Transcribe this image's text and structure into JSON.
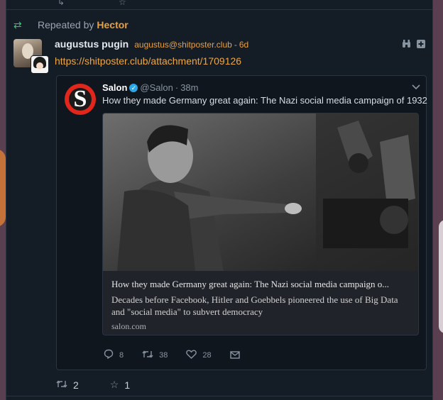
{
  "notice": {
    "prefix": "Repeated by",
    "user": "Hector"
  },
  "status": {
    "display_name": "augustus pugin",
    "account": "augustus@shitposter.club",
    "separator": "-",
    "time": "6d",
    "link": "https://shitposter.club/attachment/1709126"
  },
  "quote": {
    "name": "Salon",
    "handle": "@Salon",
    "separator": "·",
    "time": "38m",
    "text": "How they made Germany great again: The Nazi social media campaign of 1932",
    "preview": {
      "title": "How they made Germany great again: The Nazi social media campaign o...",
      "description": "Decades before Facebook, Hitler and Goebbels pioneered the use of Big Data and \"social media\" to subvert democracy",
      "domain": "salon.com"
    },
    "actions": {
      "replies": "8",
      "retweets": "38",
      "likes": "28"
    }
  },
  "counts": {
    "repeats": "2",
    "favorites": "1"
  },
  "icons": {
    "repeat": "repeat-icon",
    "binoculars": "binoculars-icon",
    "expand": "plus-square-icon",
    "verified": "verified-badge-icon",
    "chevron": "chevron-down-icon",
    "reply": "speech-bubble-icon",
    "retweet": "retweet-icon",
    "like": "heart-icon",
    "message": "envelope-icon",
    "star": "star-icon"
  },
  "colors": {
    "accent": "#e8a040",
    "link": "#f0a640",
    "repeat_green": "#2ecc71",
    "panel": "#141c26",
    "salon_red": "#e1261c",
    "verified_blue": "#2ba7e6"
  }
}
